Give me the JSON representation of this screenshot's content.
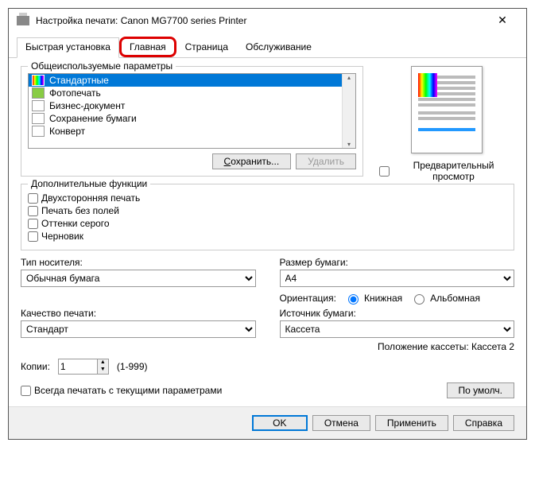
{
  "title": "Настройка печати: Canon MG7700 series Printer",
  "tabs": {
    "quick": "Быстрая установка",
    "main": "Главная",
    "page": "Страница",
    "service": "Обслуживание"
  },
  "profiles": {
    "label": "Общеиспользуемые параметры",
    "items": [
      "Стандартные",
      "Фотопечать",
      "Бизнес-документ",
      "Сохранение бумаги",
      "Конверт"
    ],
    "save_btn": "Сохранить...",
    "delete_btn": "Удалить"
  },
  "preview_checkbox": "Предварительный просмотр",
  "functions": {
    "label": "Дополнительные функции",
    "duplex": "Двухсторонняя печать",
    "borderless": "Печать без полей",
    "grayscale": "Оттенки серого",
    "draft": "Черновик"
  },
  "media": {
    "type_label": "Тип носителя:",
    "type_value": "Обычная бумага",
    "quality_label": "Качество печати:",
    "quality_value": "Стандарт"
  },
  "paper": {
    "size_label": "Размер бумаги:",
    "size_value": "A4",
    "orient_label": "Ориентация:",
    "portrait": "Книжная",
    "landscape": "Альбомная",
    "source_label": "Источник бумаги:",
    "source_value": "Кассета",
    "cassette_info": "Положение кассеты: Кассета 2"
  },
  "copies": {
    "label": "Копии:",
    "value": "1",
    "range": "(1-999)"
  },
  "always_print": "Всегда печатать с текущими параметрами",
  "defaults_btn": "По умолч.",
  "footer": {
    "ok": "OK",
    "cancel": "Отмена",
    "apply": "Применить",
    "help": "Справка"
  }
}
